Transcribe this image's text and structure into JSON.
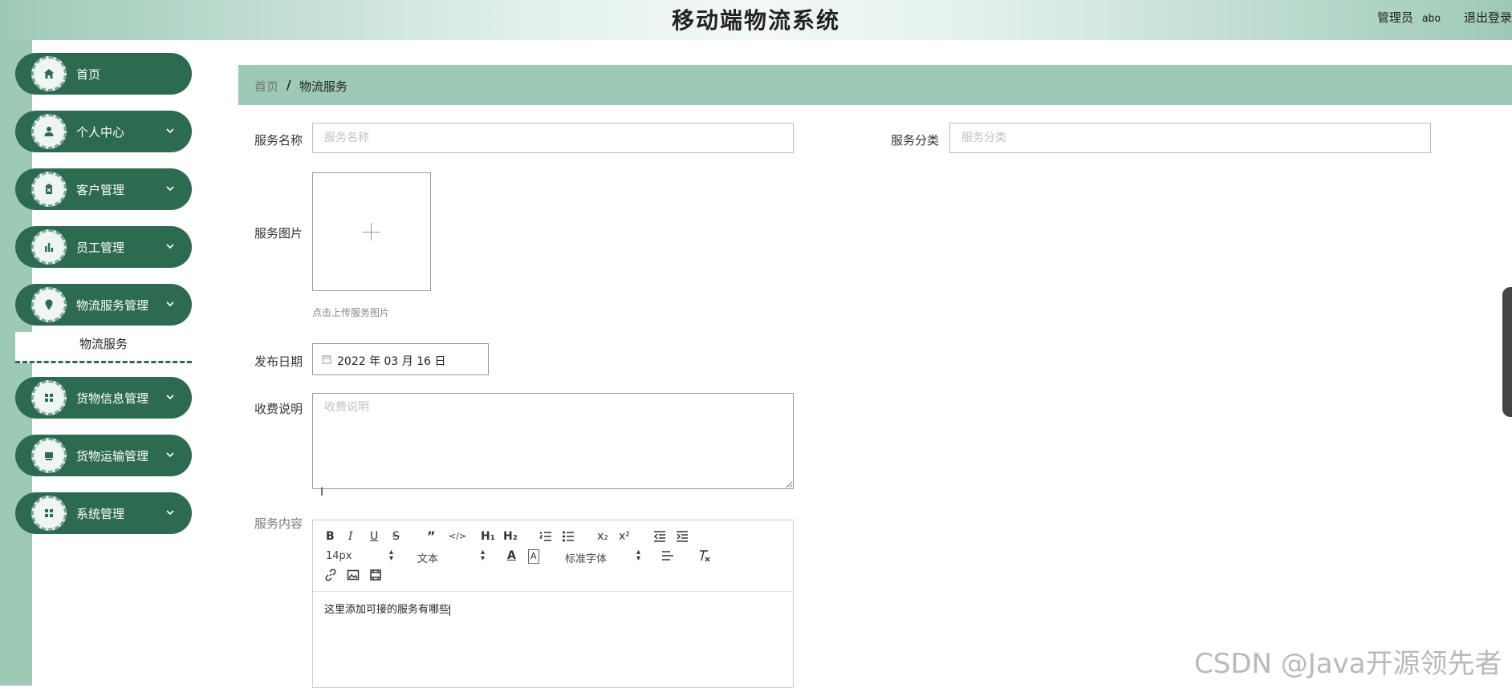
{
  "header": {
    "title": "移动端物流系统",
    "role": "管理员",
    "username": "abo",
    "logout": "退出登录"
  },
  "sidebar": {
    "items": [
      {
        "label": "首页",
        "icon": "home-icon",
        "has_arrow": false
      },
      {
        "label": "个人中心",
        "icon": "user-icon",
        "has_arrow": true
      },
      {
        "label": "客户管理",
        "icon": "clipboard-icon",
        "has_arrow": true
      },
      {
        "label": "员工管理",
        "icon": "bar-chart-icon",
        "has_arrow": true
      },
      {
        "label": "物流服务管理",
        "icon": "location-pin-icon",
        "has_arrow": true
      },
      {
        "label": "货物信息管理",
        "icon": "grid-icon",
        "has_arrow": true
      },
      {
        "label": "货物运输管理",
        "icon": "box-icon",
        "has_arrow": true
      },
      {
        "label": "系统管理",
        "icon": "grid-icon",
        "has_arrow": true
      }
    ],
    "submenu_active": "物流服务"
  },
  "breadcrumb": {
    "home": "首页",
    "separator": "/",
    "current": "物流服务"
  },
  "form": {
    "service_name": {
      "label": "服务名称",
      "placeholder": "服务名称",
      "value": ""
    },
    "service_category": {
      "label": "服务分类",
      "placeholder": "服务分类",
      "value": ""
    },
    "service_image": {
      "label": "服务图片",
      "hint": "点击上传服务图片"
    },
    "publish_date": {
      "label": "发布日期",
      "value": "2022 年 03 月 16 日"
    },
    "fee_description": {
      "label": "收费说明",
      "placeholder": "收费说明",
      "value": ""
    },
    "service_content": {
      "label": "服务内容",
      "content": "这里添加可接的服务有哪些",
      "toolbar": {
        "bold": "B",
        "italic": "I",
        "underline": "U",
        "strike": "S",
        "quote": "”",
        "code": "</>",
        "h1": "H₁",
        "h2": "H₂",
        "subscript": "x₂",
        "superscript": "x²",
        "font_size": "14px",
        "text_style": "文本",
        "font_family": "标准字体"
      }
    }
  },
  "watermark": "CSDN @Java开源领先者",
  "colors": {
    "sidebar_green": "#2d6b50",
    "strip_green": "#9ec9b6",
    "breadcrumb_bg": "#9ec9b6"
  }
}
